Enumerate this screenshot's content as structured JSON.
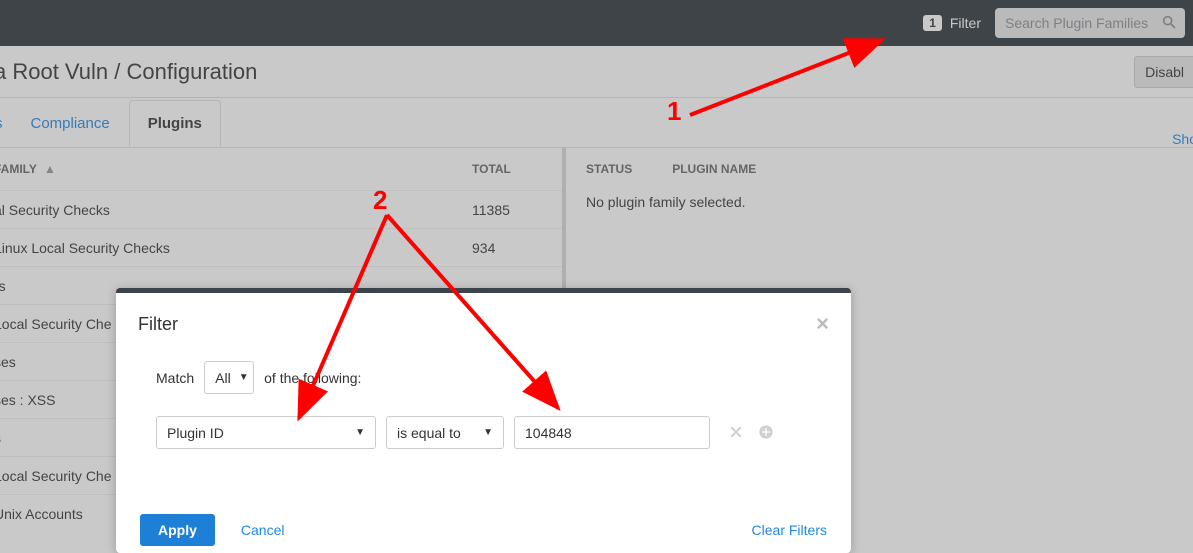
{
  "topbar": {
    "filter_count": "1",
    "filter_label": "Filter",
    "search_placeholder": "Search Plugin Families"
  },
  "page": {
    "title": "a Root Vuln / Configuration",
    "disable_button": "Disabl"
  },
  "tabs": {
    "left_fragment": "s",
    "items": [
      "Compliance",
      "Plugins"
    ],
    "active_index": 1,
    "show_link": "Sho"
  },
  "families_table": {
    "header_family": "FAMILY",
    "header_total": "TOTAL",
    "rows": [
      {
        "name": "al Security Checks",
        "total": "11385"
      },
      {
        "name": " Linux Local Security Checks",
        "total": "934"
      },
      {
        "name": "rs",
        "total": ""
      },
      {
        "name": " Local Security Che",
        "total": ""
      },
      {
        "name": "ses",
        "total": ""
      },
      {
        "name": "ses : XSS",
        "total": ""
      },
      {
        "name": "s",
        "total": ""
      },
      {
        "name": "Local Security Che",
        "total": ""
      },
      {
        "name": "Unix Accounts",
        "total": ""
      }
    ]
  },
  "right_panel": {
    "header_status": "STATUS",
    "header_plugin_name": "PLUGIN NAME",
    "empty_message": "No plugin family selected."
  },
  "modal": {
    "title": "Filter",
    "match_label_pre": "Match",
    "match_mode": "All",
    "match_label_post": "of the following:",
    "rule": {
      "field": "Plugin ID",
      "operator": "is equal to",
      "value": "104848"
    },
    "apply": "Apply",
    "cancel": "Cancel",
    "clear": "Clear Filters"
  },
  "annotations": {
    "n1": "1",
    "n2": "2"
  }
}
